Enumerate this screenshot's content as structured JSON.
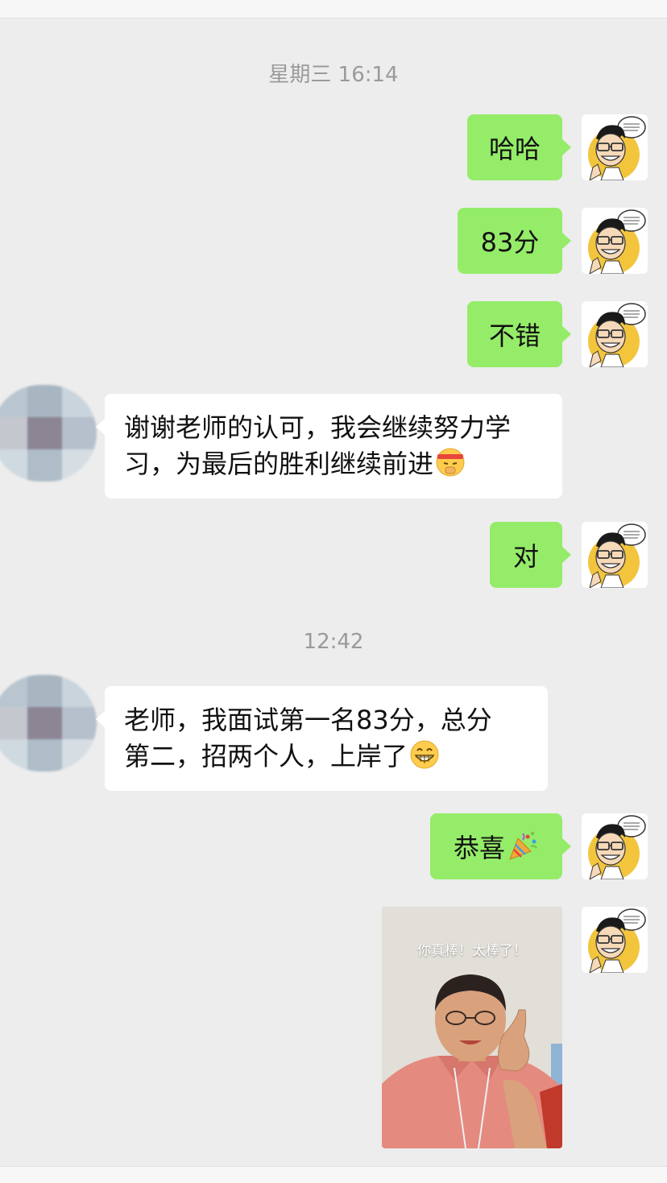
{
  "timestamps": [
    "星期三 16:14",
    "12:42"
  ],
  "messages": {
    "m1": "哈哈",
    "m2": "83分",
    "m3": "不错",
    "m4_line1": "谢谢老师的认可，我会继续努力学",
    "m4_line2": "习，为最后的胜利继续前进",
    "m5": "对",
    "m6_line1": "老师，我面试第一名83分，总分",
    "m6_line2": "第二，招两个人，上岸了",
    "m7": "恭喜"
  },
  "image_message": {
    "caption": "你真棒！太棒了！"
  },
  "colors": {
    "bg": "#ededed",
    "my_bubble": "#95ec69",
    "other_bubble": "#ffffff",
    "time_text": "#9a9a9a"
  },
  "icons": [
    "headband-fist-emoji",
    "grin-emoji",
    "party-popper-emoji",
    "cartoon-avatar",
    "mosaic-avatar"
  ]
}
